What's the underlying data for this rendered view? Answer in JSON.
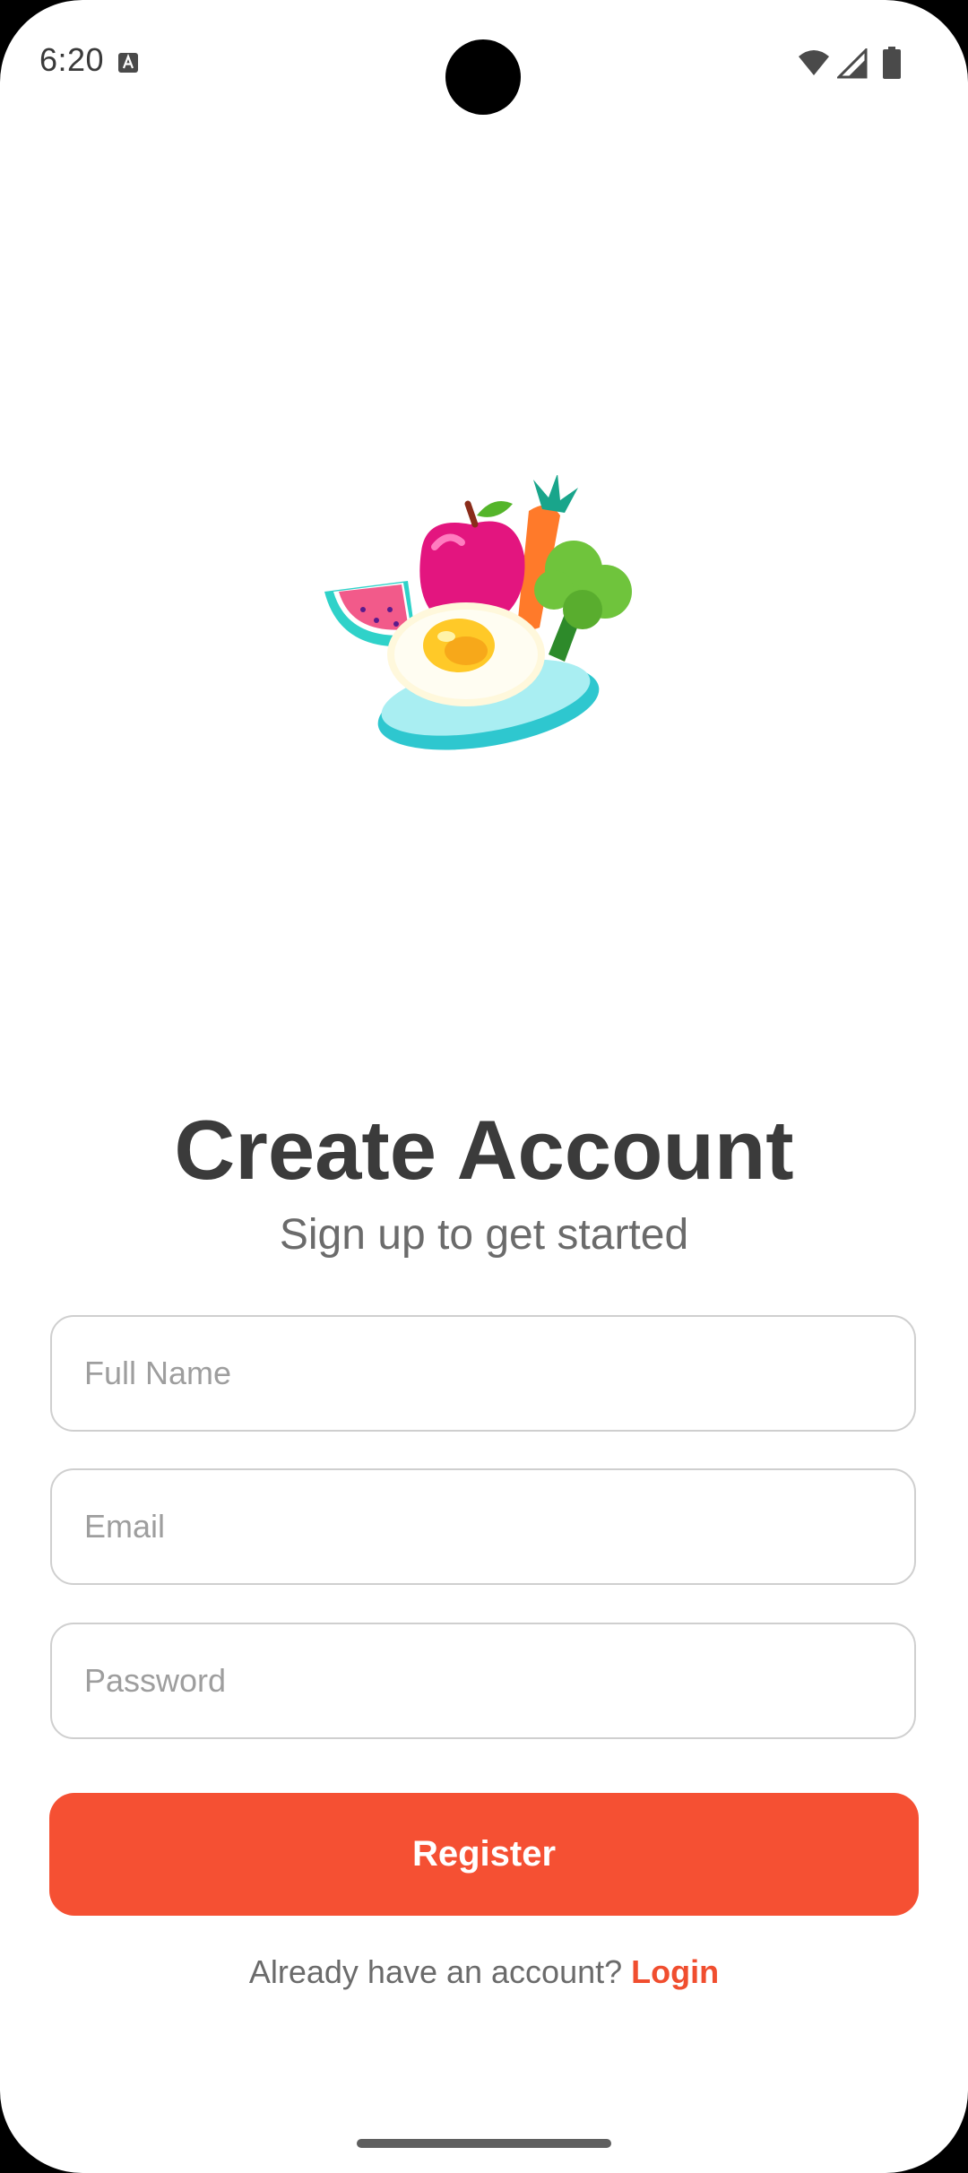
{
  "status_bar": {
    "time": "6:20",
    "icons": [
      "keyboard-a-icon",
      "wifi-icon",
      "signal-icon",
      "battery-icon"
    ]
  },
  "hero": {
    "illustration": "food-illustration-icon"
  },
  "header": {
    "title": "Create Account",
    "subtitle": "Sign up to get started"
  },
  "form": {
    "full_name_placeholder": "Full Name",
    "email_placeholder": "Email",
    "password_placeholder": "Password",
    "register_label": "Register"
  },
  "footer": {
    "prompt": "Already have an account?",
    "login_label": "Login"
  },
  "colors": {
    "accent": "#f55033",
    "title": "#3b3b3b",
    "subtitle": "#6b6b6b",
    "border": "#cfcfcf"
  }
}
